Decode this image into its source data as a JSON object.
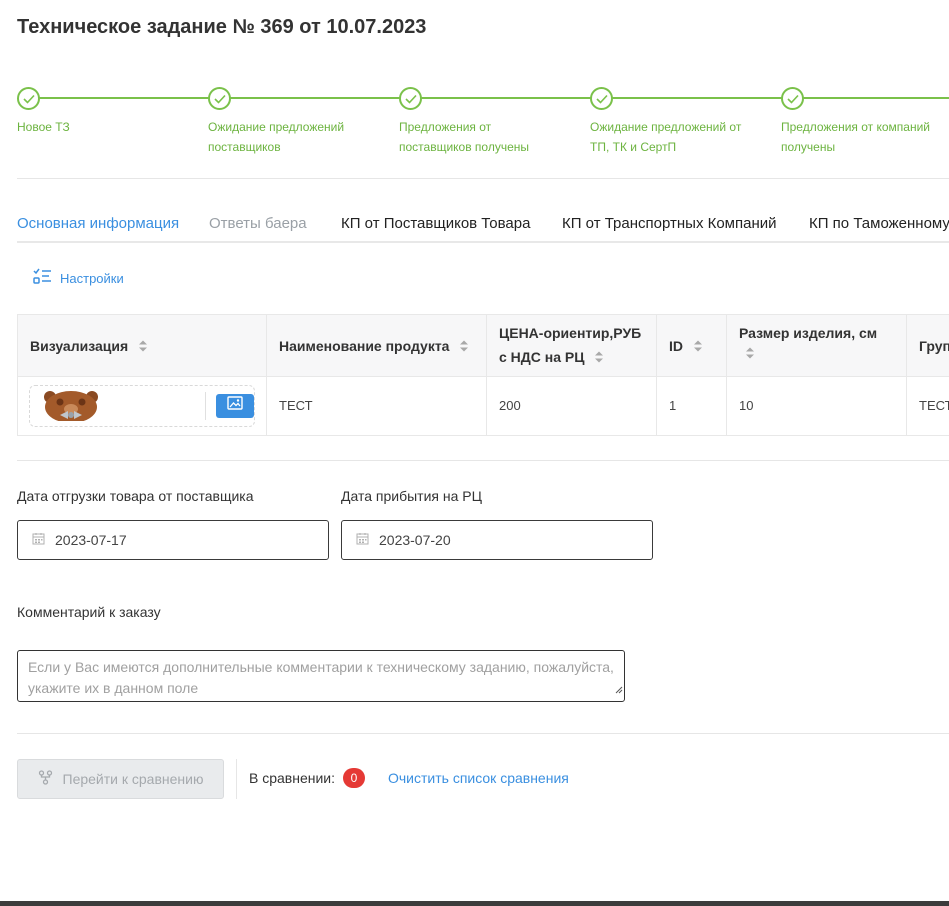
{
  "title": "Техническое задание № 369 от 10.07.2023",
  "steps": [
    {
      "label": "Новое ТЗ"
    },
    {
      "label": "Ожидание предложений поставщиков"
    },
    {
      "label": "Предложения от поставщиков получены"
    },
    {
      "label": "Ожидание предложений от ТП, ТК и СертП"
    },
    {
      "label": "Предложения от компаний получены"
    }
  ],
  "tabs": [
    {
      "label": "Основная информация"
    },
    {
      "label": "Ответы баера"
    },
    {
      "label": "КП от Поставщиков Товара"
    },
    {
      "label": "КП от Транспортных Компаний"
    },
    {
      "label": "КП по Таможенному Оформлению"
    }
  ],
  "settings_label": "Настройки",
  "table": {
    "columns": [
      {
        "line1": "Визуализация",
        "line2": ""
      },
      {
        "line1": "Наименование продукта",
        "line2": ""
      },
      {
        "line1": "ЦЕНА-ориентир,РУБ",
        "line2": "с НДС на РЦ"
      },
      {
        "line1": "ID",
        "line2": ""
      },
      {
        "line1": "Размер изделия, см",
        "line2": ""
      },
      {
        "line1": "Группа",
        "line2": ""
      }
    ],
    "rows": [
      {
        "name": "ТЕСТ",
        "price": "200",
        "id": "1",
        "size": "10",
        "group": "ТЕСТ"
      }
    ]
  },
  "form": {
    "ship_date_label": "Дата отгрузки товара от поставщика",
    "ship_date_value": "2023-07-17",
    "arrival_date_label": "Дата прибытия на РЦ",
    "arrival_date_value": "2023-07-20",
    "comment_label": "Комментарий к заказу",
    "comment_placeholder": "Если у Вас имеются дополнительные комментарии к техническому заданию, пожалуйста, укажите их в данном поле"
  },
  "compare": {
    "button_label": "Перейти к сравнению",
    "in_compare_label": "В сравнении:",
    "count": "0",
    "clear_label": "Очистить список сравнения"
  },
  "colors": {
    "accent": "#3a8fe0",
    "step_green": "#7ac14a",
    "badge_red": "#e53935"
  }
}
